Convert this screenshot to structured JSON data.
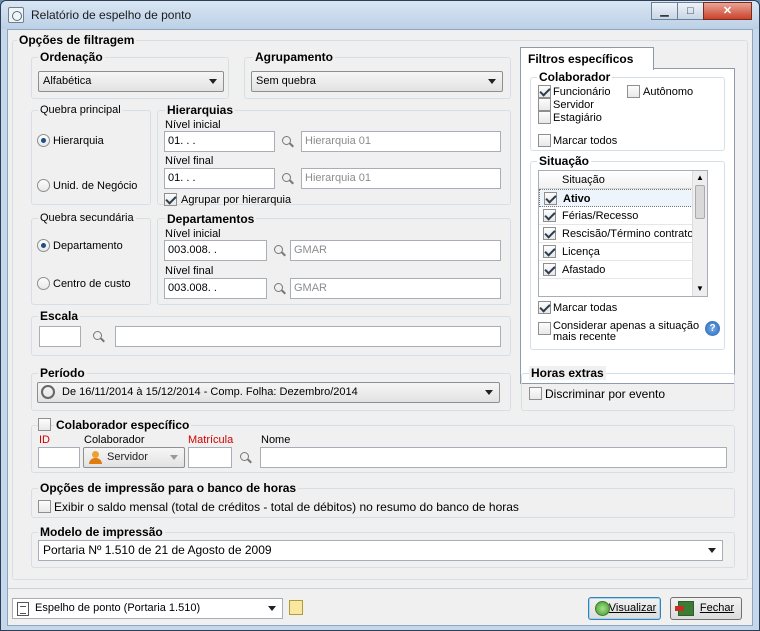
{
  "window": {
    "title": "Relatório de espelho de ponto"
  },
  "filters": {
    "title": "Opções de filtragem",
    "ordenacao": {
      "label": "Ordenação",
      "value": "Alfabética"
    },
    "agrupamento": {
      "label": "Agrupamento",
      "value": "Sem quebra"
    },
    "quebra_principal": {
      "label": "Quebra principal",
      "options": [
        "Hierarquia",
        "Unid. de Negócio"
      ]
    },
    "hierarquias": {
      "label": "Hierarquias",
      "inicial_label": "Nível inicial",
      "inicial_code": "01.   .   .",
      "inicial_desc": "Hierarquia 01",
      "final_label": "Nível final",
      "final_code": "01.   .   .",
      "final_desc": "Hierarquia 01",
      "agrupar": "Agrupar por hierarquia"
    },
    "quebra_secundaria": {
      "label": "Quebra secundária",
      "options": [
        "Departamento",
        "Centro de custo"
      ]
    },
    "departamentos": {
      "label": "Departamentos",
      "inicial_label": "Nível inicial",
      "inicial_code": "003.008.   .",
      "inicial_desc": "GMAR",
      "final_label": "Nível final",
      "final_code": "003.008.   .",
      "final_desc": "GMAR"
    },
    "escala": {
      "label": "Escala"
    }
  },
  "specific": {
    "tab": "Filtros específicos",
    "colaborador": {
      "label": "Colaborador",
      "funcionario": "Funcionário",
      "autonomo": "Autônomo",
      "servidor": "Servidor",
      "estagiario": "Estagiário",
      "marcar": "Marcar todos"
    },
    "situacao": {
      "label": "Situação",
      "header": "Situação",
      "rows": [
        "Ativo",
        "Férias/Recesso",
        "Rescisão/Término contrato",
        "Licença",
        "Afastado"
      ],
      "marcar": "Marcar todas",
      "considerar": "Considerar apenas a situação",
      "considerar2": "mais recente"
    }
  },
  "periodo": {
    "label": "Período",
    "value": "De 16/11/2014 à 15/12/2014 - Comp. Folha: Dezembro/2014"
  },
  "horas": {
    "label": "Horas extras",
    "discriminar": "Discriminar por evento"
  },
  "colab_esp": {
    "label": "Colaborador específico",
    "id": "ID",
    "colaborador": "Colaborador",
    "matricula": "Matrícula",
    "nome": "Nome",
    "tipo": "Servidor"
  },
  "banco": {
    "label": "Opções de impressão para o banco de horas",
    "exibir": "Exibir o saldo mensal (total de créditos - total de débitos) no resumo do banco de horas"
  },
  "modelo": {
    "label": "Modelo de impressão",
    "value": "Portaria Nº 1.510 de 21 de Agosto de 2009"
  },
  "footer": {
    "report": "Espelho de ponto (Portaria 1.510)",
    "visualizar": "Visualizar",
    "fechar": "Fechar"
  },
  "colors": {
    "titlebar": "#c5d7ea",
    "accent": "#1d5fb4",
    "required": "#d40000"
  }
}
